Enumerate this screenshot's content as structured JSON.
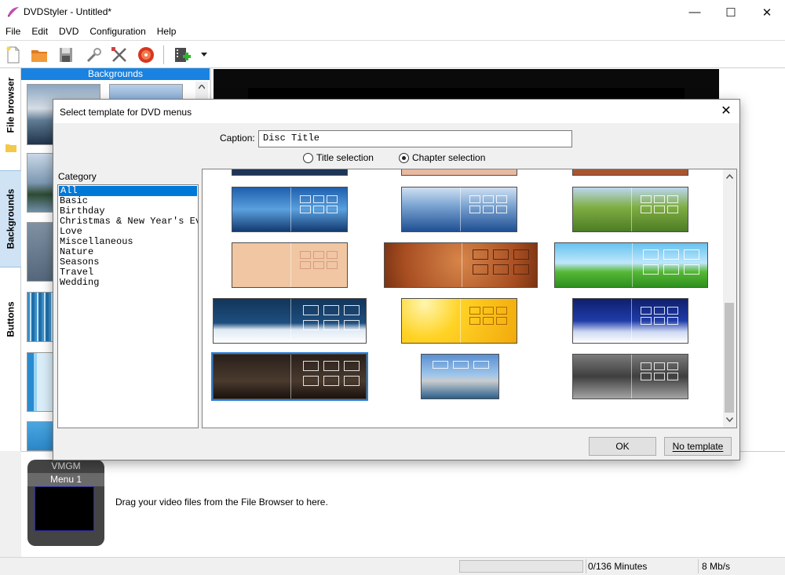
{
  "window": {
    "title": "DVDStyler - Untitled*",
    "minimize": "—",
    "maximize": "☐",
    "close": "✕"
  },
  "menu": [
    "File",
    "Edit",
    "DVD",
    "Configuration",
    "Help"
  ],
  "side_tabs": [
    "File browser",
    "Backgrounds",
    "Buttons"
  ],
  "backgrounds_panel": {
    "header": "Backgrounds"
  },
  "dialog": {
    "title": "Select template for DVD menus",
    "close": "✕",
    "caption_label": "Caption:",
    "caption_value": "Disc Title",
    "radio_title": "Title selection",
    "radio_chapter": "Chapter selection",
    "category_label": "Category",
    "categories": [
      "All",
      "Basic",
      "Birthday",
      "Christmas & New Year's Eve",
      "Love",
      "Miscellaneous",
      "Nature",
      "Seasons",
      "Travel",
      "Wedding"
    ],
    "ok": "OK",
    "no_template": "No template"
  },
  "titleset": {
    "vmgm": "VMGM",
    "menu1": "Menu 1",
    "hint": "Drag your video files from the File Browser to here."
  },
  "status": {
    "minutes": "0/136 Minutes",
    "rate": "8 Mb/s"
  },
  "colors": {
    "accent": "#0078d7",
    "panel_header": "#1a82e0"
  }
}
